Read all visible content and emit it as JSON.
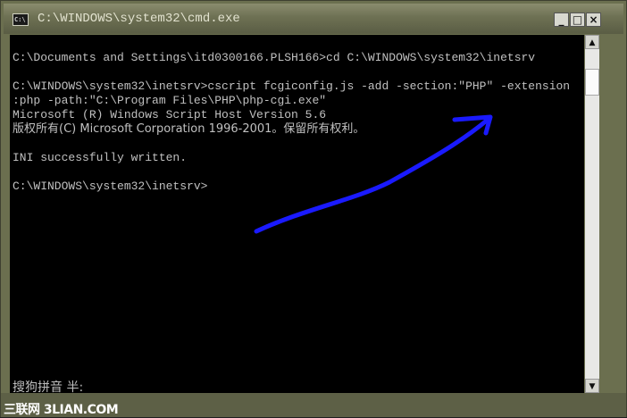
{
  "window": {
    "title": "C:\\WINDOWS\\system32\\cmd.exe",
    "icon_label": "C:\\",
    "buttons": {
      "minimize": "_",
      "maximize": "□",
      "close": "×"
    }
  },
  "console": {
    "lines": [
      "C:\\Documents and Settings\\itd0300166.PLSH166>cd C:\\WINDOWS\\system32\\inetsrv",
      "",
      "C:\\WINDOWS\\system32\\inetsrv>cscript fcgiconfig.js -add -section:\"PHP\" -extension",
      ":php -path:\"C:\\Program Files\\PHP\\php-cgi.exe\"",
      "Microsoft (R) Windows Script Host Version 5.6",
      "版权所有(C) Microsoft Corporation 1996-2001。保留所有权利。",
      "",
      "INI successfully written.",
      "",
      "C:\\WINDOWS\\system32\\inetsrv>"
    ],
    "text_color": "#c0c0c0",
    "background": "#000000"
  },
  "ime": {
    "status": "搜狗拼音 半:"
  },
  "scrollbar": {
    "up_arrow": "▲",
    "down_arrow": "▼"
  },
  "annotation": {
    "arrow_color": "#1a1aff"
  },
  "watermark": {
    "text": "三联网 3LIAN.COM"
  }
}
